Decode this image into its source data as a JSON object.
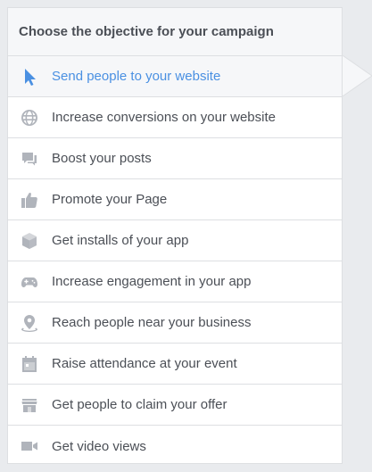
{
  "panel": {
    "title": "Choose the objective for your campaign"
  },
  "objectives": [
    {
      "label": "Send people to your website",
      "icon": "cursor-icon",
      "selected": true
    },
    {
      "label": "Increase conversions on your website",
      "icon": "globe-icon",
      "selected": false
    },
    {
      "label": "Boost your posts",
      "icon": "chat-bubbles-icon",
      "selected": false
    },
    {
      "label": "Promote your Page",
      "icon": "thumbs-up-icon",
      "selected": false
    },
    {
      "label": "Get installs of your app",
      "icon": "box-icon",
      "selected": false
    },
    {
      "label": "Increase engagement in your app",
      "icon": "gamepad-icon",
      "selected": false
    },
    {
      "label": "Reach people near your business",
      "icon": "map-pin-icon",
      "selected": false
    },
    {
      "label": "Raise attendance at your event",
      "icon": "calendar-icon",
      "selected": false
    },
    {
      "label": "Get people to claim your offer",
      "icon": "storefront-icon",
      "selected": false
    },
    {
      "label": "Get video views",
      "icon": "video-camera-icon",
      "selected": false
    }
  ],
  "colors": {
    "accent": "#4a90e2",
    "text": "#4b4f56",
    "icon": "#b0b4bb",
    "background": "#e9ebee",
    "header_bg": "#f6f7f9"
  }
}
